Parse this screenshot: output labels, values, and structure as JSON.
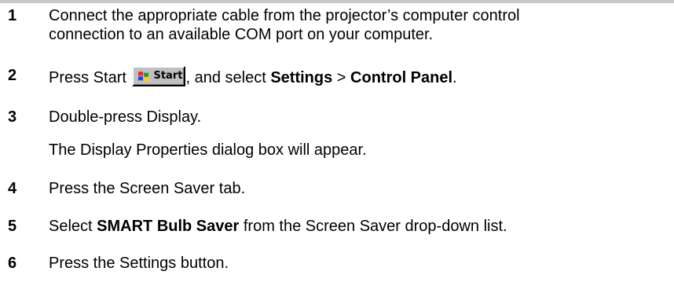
{
  "steps": [
    {
      "num": "1",
      "line1": "Connect the appropriate cable from the projector’s computer control",
      "line2": "connection to an available COM port on your computer."
    },
    {
      "num": "2",
      "before": "Press Start ",
      "middle": ", and select ",
      "bold1": "Settings",
      "sep": " > ",
      "bold2": "Control Panel",
      "after": "."
    },
    {
      "num": "3",
      "text": "Double-press Display.",
      "note": "The Display Properties dialog box will appear."
    },
    {
      "num": "4",
      "text": "Press the Screen Saver tab."
    },
    {
      "num": "5",
      "before": "Select ",
      "bold": "SMART Bulb Saver",
      "after": " from the Screen Saver drop-down list."
    },
    {
      "num": "6",
      "text": "Press the Settings button."
    }
  ],
  "start_button": {
    "label": "Start",
    "icon": "windows-logo-icon"
  }
}
